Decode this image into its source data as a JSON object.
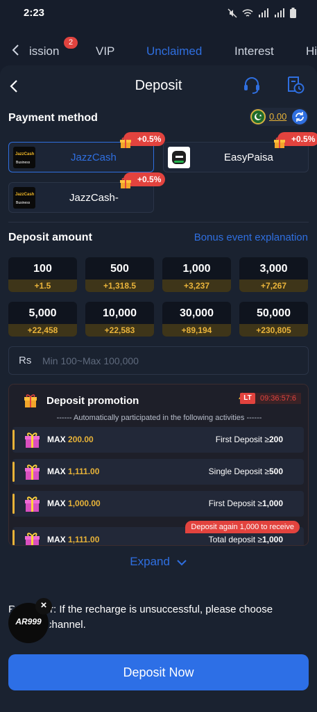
{
  "status_bar": {
    "time": "2:23"
  },
  "top_tabs": [
    {
      "label": "ission"
    },
    {
      "label": "VIP"
    },
    {
      "label": "Unclaimed"
    },
    {
      "label": "Interest"
    },
    {
      "label": "Hi"
    }
  ],
  "tab_badge": "2",
  "header": {
    "title": "Deposit"
  },
  "payment": {
    "title": "Payment method",
    "balance": "0.00",
    "methods": [
      {
        "label": "JazzCash",
        "bonus": "+0.5%",
        "logo_text": "JazzCash",
        "logo_sub": "Business",
        "selected": true
      },
      {
        "label": "EasyPaisa",
        "bonus": "+0.5%",
        "selected": false
      },
      {
        "label": "JazzCash-",
        "bonus": "+0.5%",
        "logo_text": "JazzCash",
        "logo_sub": "Business",
        "selected": false
      }
    ]
  },
  "deposit": {
    "title": "Deposit amount",
    "bonus_link": "Bonus event explanation",
    "amounts": [
      {
        "value": "100",
        "bonus": "+1.5"
      },
      {
        "value": "500",
        "bonus": "+1,318.5"
      },
      {
        "value": "1,000",
        "bonus": "+3,237"
      },
      {
        "value": "3,000",
        "bonus": "+7,267"
      },
      {
        "value": "5,000",
        "bonus": "+22,458"
      },
      {
        "value": "10,000",
        "bonus": "+22,583"
      },
      {
        "value": "30,000",
        "bonus": "+89,194"
      },
      {
        "value": "50,000",
        "bonus": "+230,805"
      }
    ],
    "currency": "Rs",
    "placeholder": "Min 100~Max 100,000"
  },
  "promotion": {
    "title": "Deposit promotion",
    "timer_badge": "LT",
    "timer": "09:36:57:6",
    "subtitle": "------ Automatically participated in the following activities ------",
    "rows": [
      {
        "max_label": "MAX",
        "max_value": "200.00",
        "cond": "First Deposit ≥",
        "cond_value": "200"
      },
      {
        "max_label": "MAX",
        "max_value": "1,111.00",
        "cond": "Single Deposit ≥",
        "cond_value": "500"
      },
      {
        "max_label": "MAX",
        "max_value": "1,000.00",
        "cond": "First Deposit ≥",
        "cond_value": "1,000"
      },
      {
        "max_label": "MAX",
        "max_value": "1,111.00",
        "cond": "Total deposit ≥",
        "cond_value": "1,000"
      }
    ],
    "again_tag": "Deposit again 1,000 to receive"
  },
  "expand_label": "Expand",
  "reminder": "Reminder: If the recharge is unsuccessful, please choose another channel.",
  "float_logo_text": "AR999",
  "float_close": "×",
  "deposit_button": "Deposit Now",
  "colors": {
    "accent": "#2f6fe0",
    "gold": "#e8b338",
    "bonus_red": "#e2433e",
    "background": "#161d2b"
  }
}
